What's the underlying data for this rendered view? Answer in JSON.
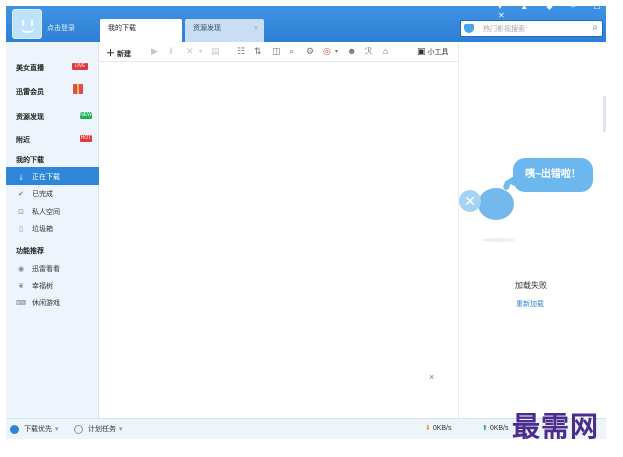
{
  "header": {
    "login_text": "点击登录",
    "window_controls": "▾ ▲ ◆ – ☐ ✕",
    "tabs": [
      {
        "label": "我的下载",
        "active": true
      },
      {
        "label": "资源发现",
        "active": false,
        "close": "×"
      }
    ],
    "search": {
      "placeholder": "热门影视搜索",
      "icon": "search-icon"
    }
  },
  "sidebar": {
    "top_items": [
      {
        "label": "美女直播",
        "badge": "LIVE"
      },
      {
        "label": "迅雷会员",
        "badge": "gift-icon"
      },
      {
        "label": "资源发现",
        "badge": "NEW"
      },
      {
        "label": "附近",
        "badge": "HOT"
      }
    ],
    "downloads_title": "我的下载",
    "downloads": [
      {
        "label": "正在下载",
        "icon": "download-icon",
        "active": true
      },
      {
        "label": "已完成",
        "icon": "check-icon"
      },
      {
        "label": "私人空间",
        "icon": "lock-icon"
      },
      {
        "label": "垃圾箱",
        "icon": "trash-icon"
      }
    ],
    "features_title": "功能推荐",
    "features": [
      {
        "label": "迅雷看看",
        "icon": "play-icon"
      },
      {
        "label": "幸福树",
        "icon": "leaf-icon"
      },
      {
        "label": "休闲游戏",
        "icon": "gamepad-icon"
      }
    ]
  },
  "toolbar": {
    "new_label": "新建",
    "tools_label": "小工具",
    "glyphs": [
      "▶",
      "‖",
      "✕",
      "▾",
      "▤",
      "☷",
      "⇅",
      "◫",
      "⌕",
      "⚙",
      "◎",
      "▾",
      "☻",
      "ℛ",
      "⌂"
    ]
  },
  "main": {
    "close_glyph": "×"
  },
  "right_panel": {
    "bubble_text": "咦~出错啦！",
    "error_text": "加载失败",
    "reload_link": "重新加载"
  },
  "statusbar": {
    "priority_label": "下载优先",
    "schedule_label": "计划任务",
    "down_speed": "0KB/s",
    "up_speed": "0KB/s",
    "caret": "▾"
  },
  "watermark": "最需网",
  "colors": {
    "accent": "#2d86d9",
    "topbar": "#3f93e4",
    "sidebar_bg": "#eef4fb",
    "bubble": "#6cb8ee"
  }
}
